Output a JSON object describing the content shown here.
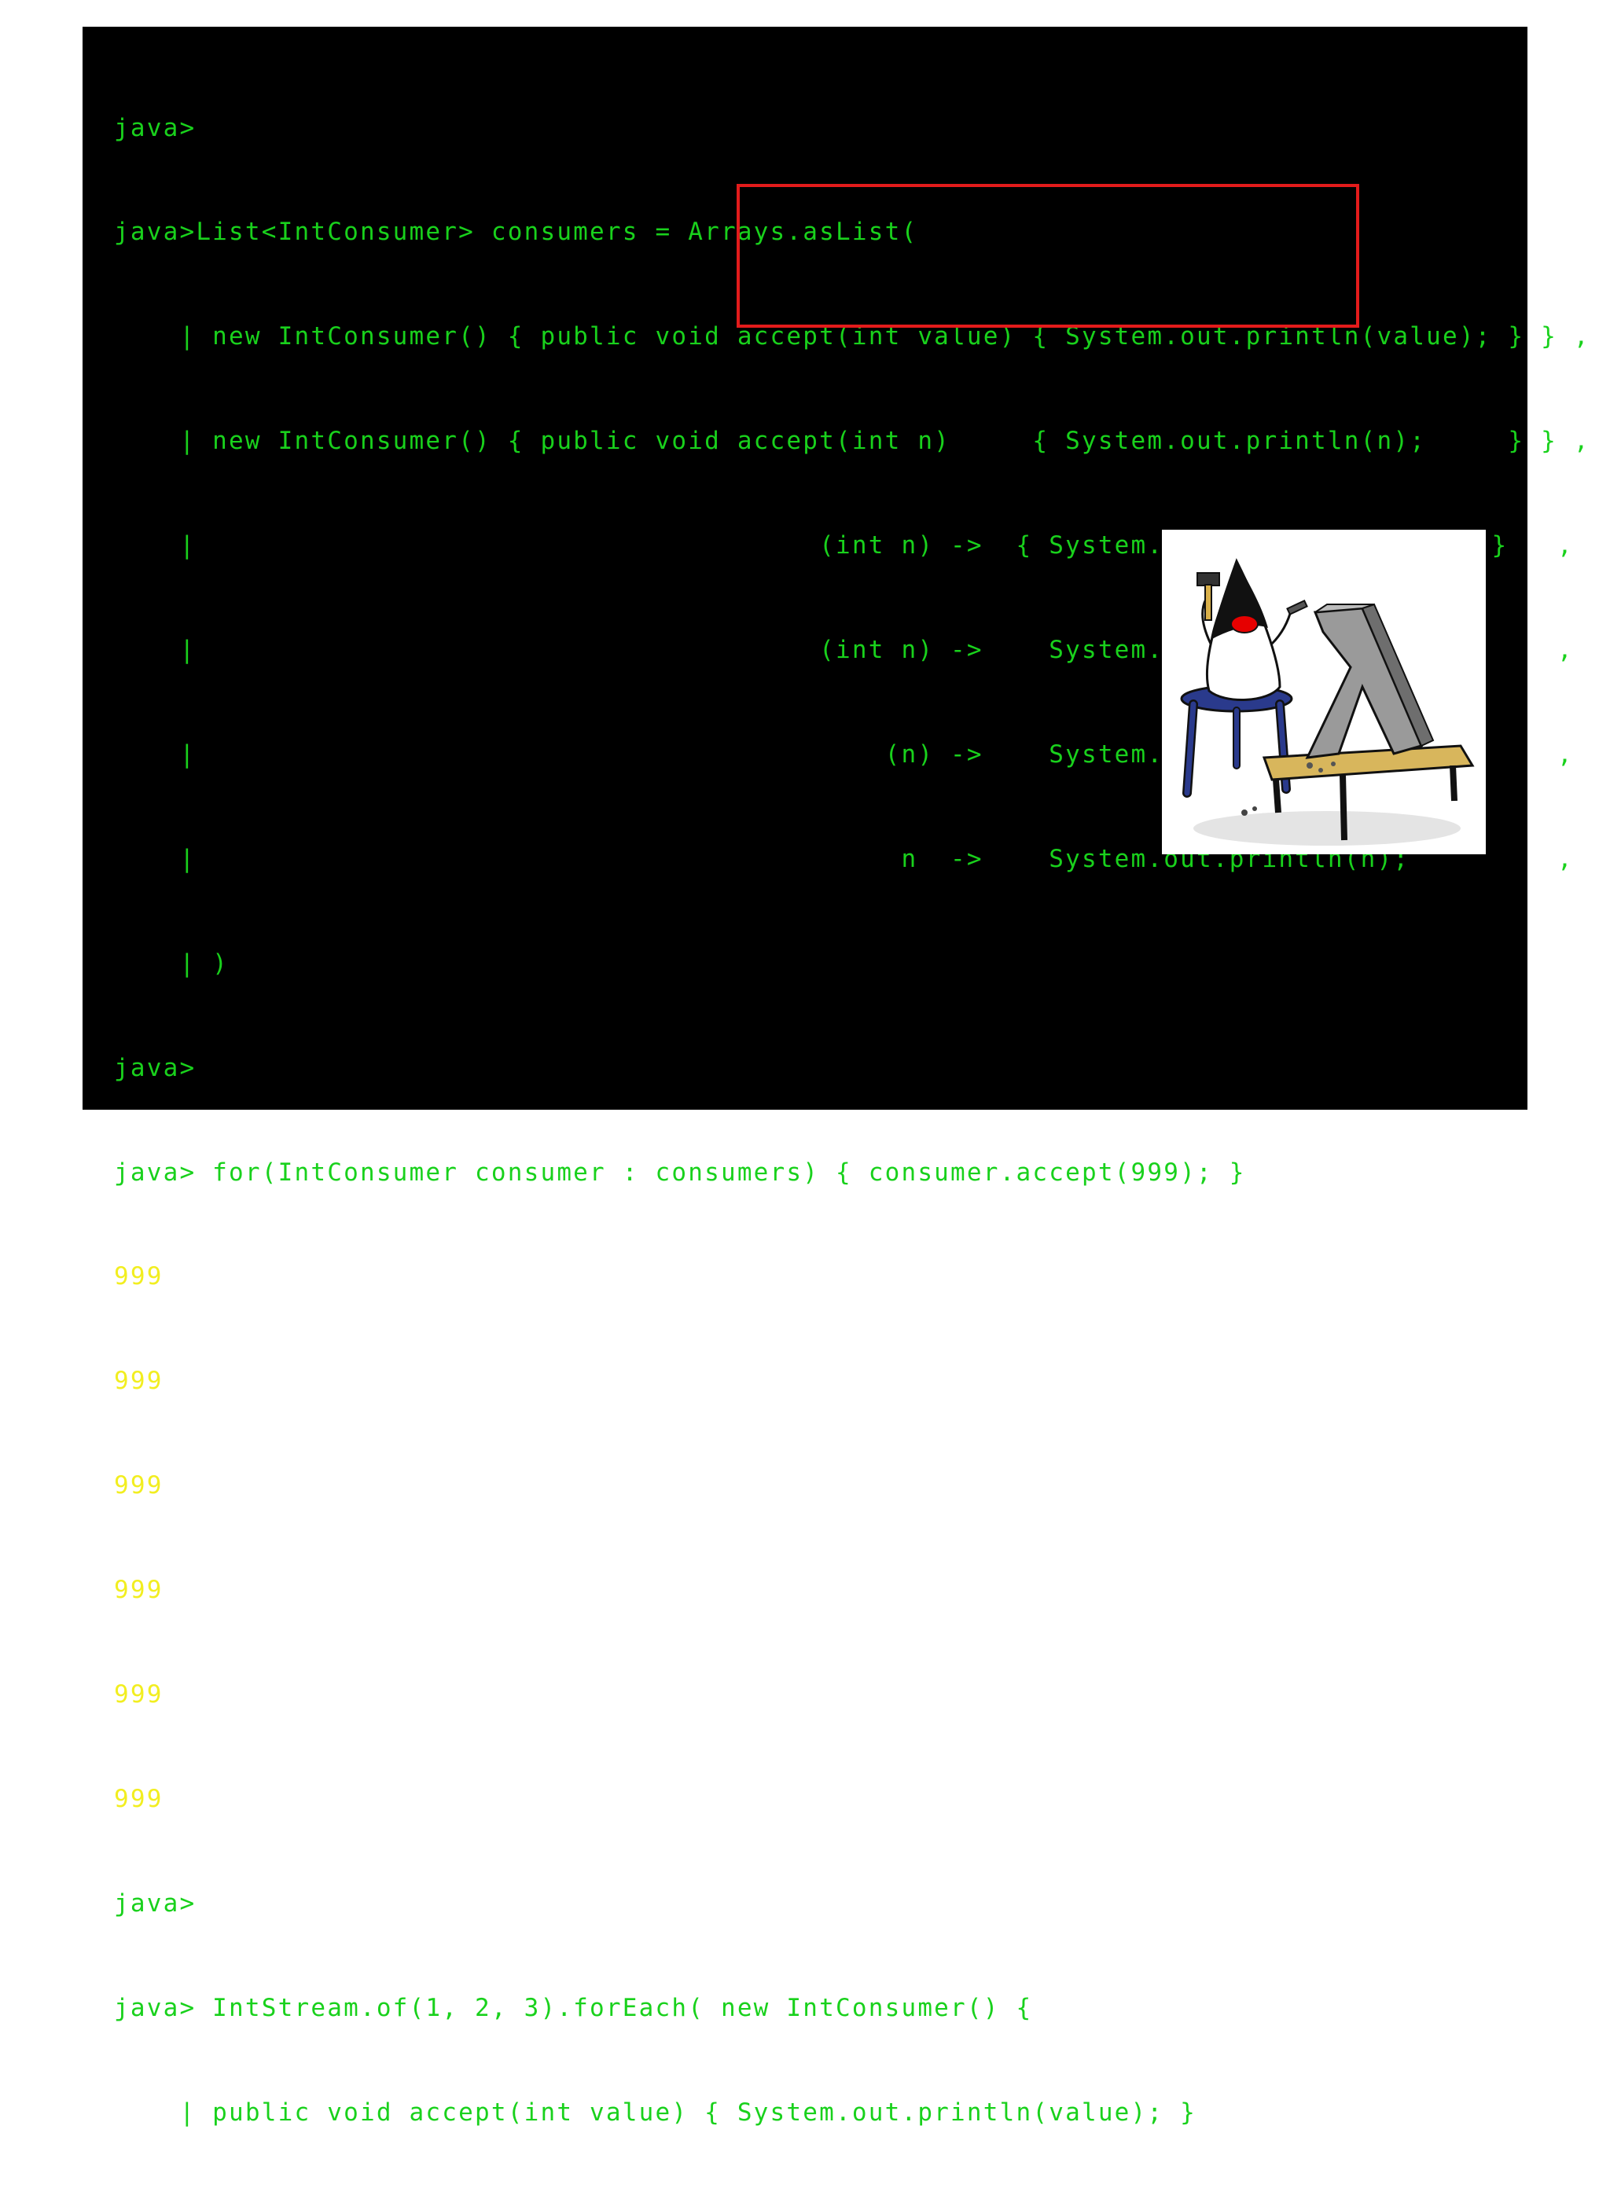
{
  "terminal": {
    "lines": [
      {
        "text": "java>",
        "color": "green"
      },
      {
        "text": "java>List<IntConsumer> consumers = Arrays.asList(",
        "color": "green"
      },
      {
        "text": "    | new IntConsumer() { public void accept(int value) { System.out.println(value); } } ,",
        "color": "green"
      },
      {
        "text": "    | new IntConsumer() { public void accept(int n)     { System.out.println(n);     } } ,",
        "color": "green"
      },
      {
        "text": "    |                                      (int n) ->  { System.out.println(n);     }   ,",
        "color": "green"
      },
      {
        "text": "    |                                      (int n) ->    System.out.println(n);         ,",
        "color": "green"
      },
      {
        "text": "    |                                          (n) ->    System.out.println(n);         ,",
        "color": "green"
      },
      {
        "text": "    |                                           n  ->    System.out.println(n);         ,",
        "color": "green"
      },
      {
        "text": "    | )",
        "color": "green"
      },
      {
        "text": "java>",
        "color": "green"
      },
      {
        "text": "java> for(IntConsumer consumer : consumers) { consumer.accept(999); }",
        "color": "green"
      },
      {
        "text": "999",
        "color": "yellow"
      },
      {
        "text": "999",
        "color": "yellow"
      },
      {
        "text": "999",
        "color": "yellow"
      },
      {
        "text": "999",
        "color": "yellow"
      },
      {
        "text": "999",
        "color": "yellow"
      },
      {
        "text": "999",
        "color": "yellow"
      },
      {
        "text": "java>",
        "color": "green"
      },
      {
        "text": "java> IntStream.of(1, 2, 3).forEach( new IntConsumer() {",
        "color": "green"
      },
      {
        "text": "    | public void accept(int value) { System.out.println(value); }",
        "color": "green"
      }
    ]
  },
  "highlight": {
    "color": "#e31b1b"
  },
  "illustration": {
    "icon": "duke-sculpting-lambda-icon"
  },
  "colors": {
    "background": "#000000",
    "prompt_text": "#19d11c",
    "output_text": "#f2ee20"
  }
}
